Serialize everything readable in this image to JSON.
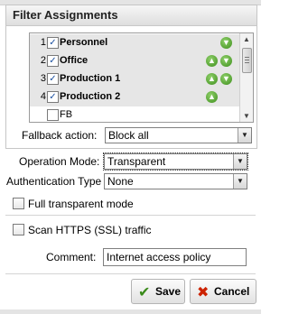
{
  "filter_assignments": {
    "title": "Filter Assignments",
    "items": [
      {
        "number": "1",
        "label": "Personnel",
        "checked": true,
        "arrows": [
          "down"
        ]
      },
      {
        "number": "2",
        "label": "Office",
        "checked": true,
        "arrows": [
          "up",
          "down"
        ]
      },
      {
        "number": "3",
        "label": "Production 1",
        "checked": true,
        "arrows": [
          "up",
          "down"
        ]
      },
      {
        "number": "4",
        "label": "Production 2",
        "checked": true,
        "arrows": [
          "up"
        ]
      },
      {
        "number": "",
        "label": "FB",
        "checked": false,
        "arrows": []
      }
    ]
  },
  "fallback": {
    "label": "Fallback action:",
    "value": "Block all"
  },
  "operation_mode": {
    "label": "Operation Mode:",
    "value": "Transparent"
  },
  "authentication": {
    "label": "Authentication Type",
    "value": "None"
  },
  "full_transparent": {
    "label": "Full transparent mode",
    "checked": false
  },
  "scan_https": {
    "label": "Scan HTTPS (SSL) traffic",
    "checked": false
  },
  "comment": {
    "label": "Comment:",
    "value": "Internet access policy"
  },
  "buttons": {
    "save": "Save",
    "cancel": "Cancel"
  },
  "colors": {
    "arrow_green": "#4a9a25",
    "cancel_red": "#cc2200",
    "save_green": "#3a8a1a",
    "checkbox_check": "#1a4fa0"
  },
  "icons": {
    "up": "arrow-up-icon",
    "down": "arrow-down-icon",
    "save": "checkmark-icon",
    "cancel": "x-icon"
  }
}
